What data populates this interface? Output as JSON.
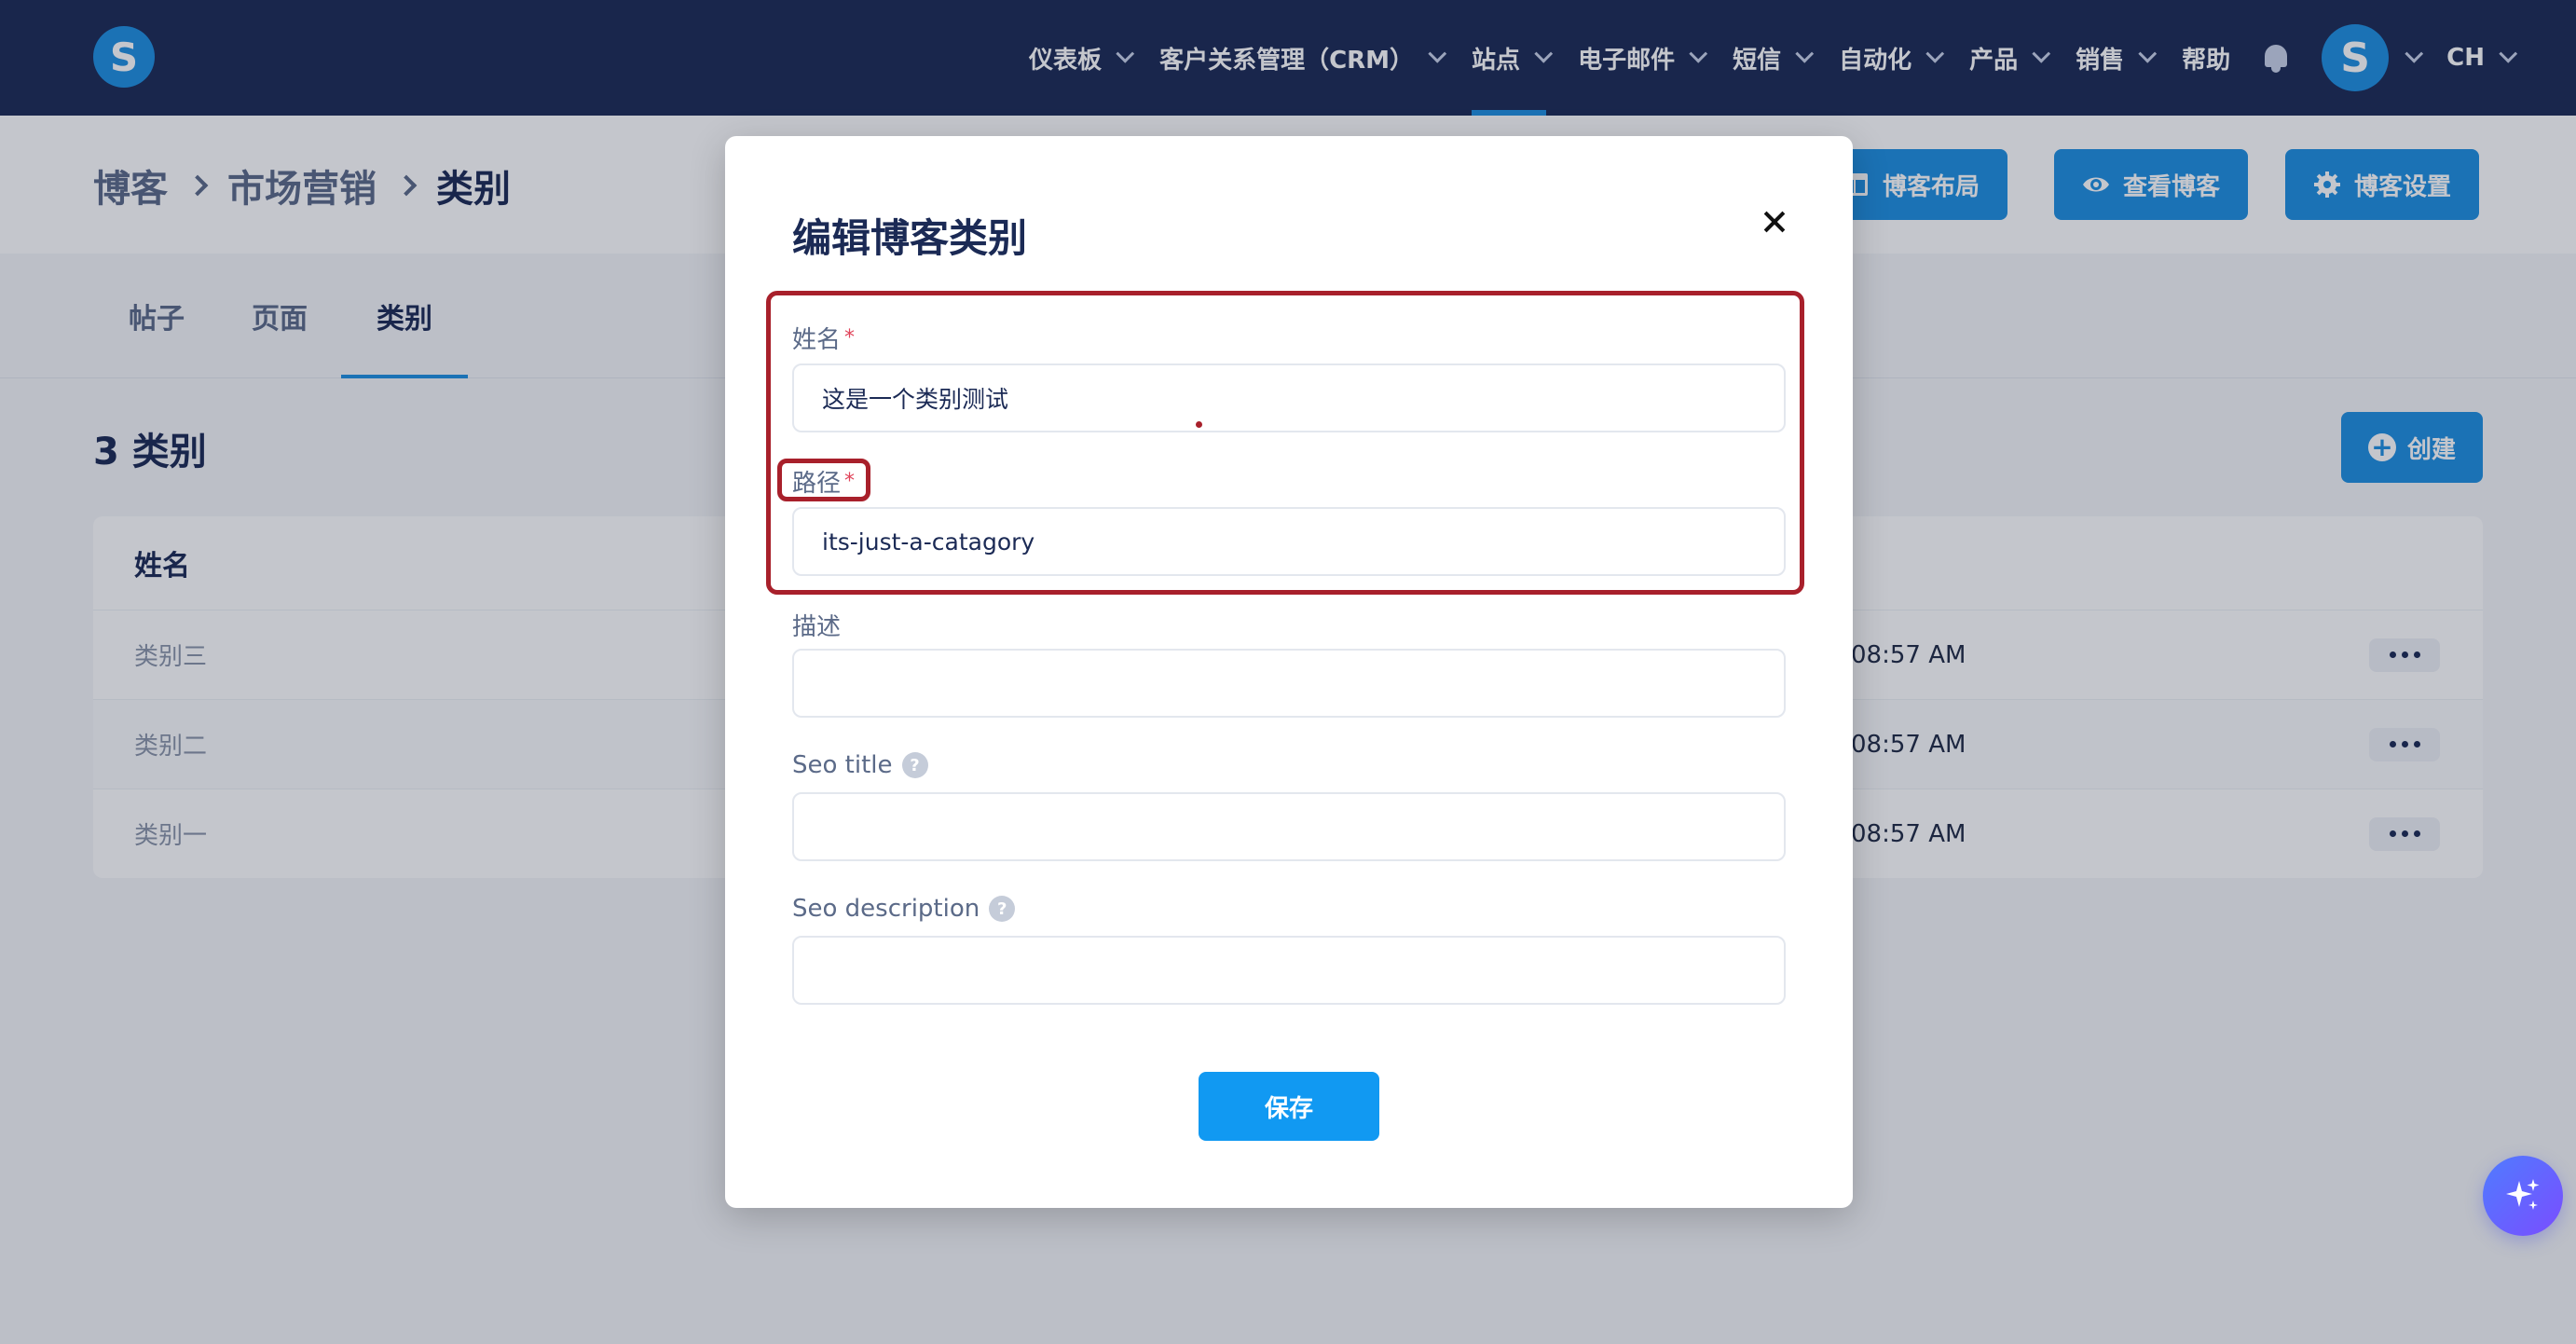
{
  "colors": {
    "nav_bg": "#1b2a55",
    "accent": "#1e8fe1",
    "highlight": "#a8202b",
    "save_button": "#1199f2"
  },
  "nav": {
    "logo_letter": "S",
    "items": [
      {
        "label": "仪表板",
        "has_dropdown": true
      },
      {
        "label": "客户关系管理（CRM）",
        "has_dropdown": true
      },
      {
        "label": "站点",
        "has_dropdown": true,
        "active": true
      },
      {
        "label": "电子邮件",
        "has_dropdown": true
      },
      {
        "label": "短信",
        "has_dropdown": true
      },
      {
        "label": "自动化",
        "has_dropdown": true
      },
      {
        "label": "产品",
        "has_dropdown": true
      },
      {
        "label": "销售",
        "has_dropdown": true
      },
      {
        "label": "帮助",
        "has_dropdown": false
      }
    ],
    "bell_icon": "bell-icon",
    "avatar_letter": "S",
    "language": "CH"
  },
  "breadcrumb": {
    "items": [
      "博客",
      "市场营销",
      "类别"
    ]
  },
  "header_buttons": {
    "layout": "博客布局",
    "view": "查看博客",
    "settings": "博客设置"
  },
  "tabs": [
    {
      "label": "帖子",
      "active": false
    },
    {
      "label": "页面",
      "active": false
    },
    {
      "label": "类别",
      "active": true
    }
  ],
  "list": {
    "count_title": "3 类别",
    "create_label": "创建",
    "column_name": "姓名",
    "rows": [
      {
        "name": "类别三",
        "time": "08:57 AM"
      },
      {
        "name": "类别二",
        "time": "08:57 AM"
      },
      {
        "name": "类别一",
        "time": "08:57 AM"
      }
    ]
  },
  "modal": {
    "title": "编辑博客类别",
    "fields": {
      "name": {
        "label": "姓名",
        "required": "*",
        "value": "这是一个类别测试"
      },
      "path": {
        "label": "路径",
        "required": "*",
        "value": "its-just-a-catagory"
      },
      "description": {
        "label": "描述",
        "value": ""
      },
      "seo_title": {
        "label": "Seo title",
        "help": "?",
        "value": ""
      },
      "seo_description": {
        "label": "Seo description",
        "help": "?",
        "value": ""
      }
    },
    "save_label": "保存"
  }
}
